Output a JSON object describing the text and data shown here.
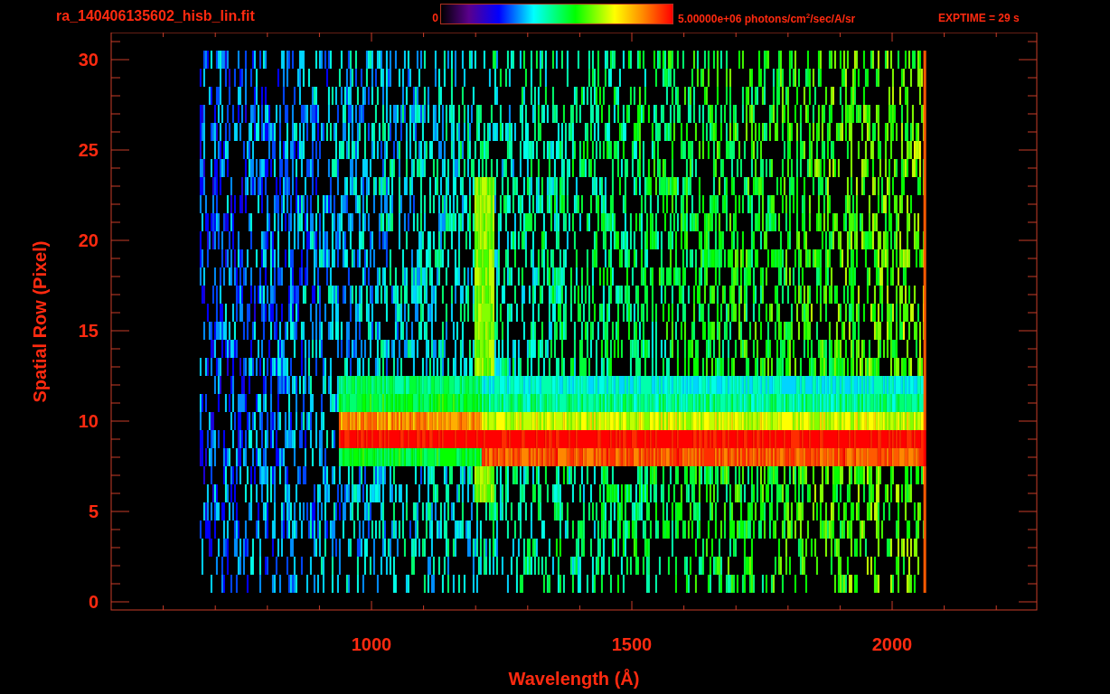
{
  "header": {
    "file_name": "ra_140406135602_hisb_lin.fit",
    "colorbar": {
      "min_label": "0",
      "max_label": "5.00000e+06 photons/cm$^{2}$/sec/A/sr"
    },
    "exposure": "EXPTIME = 29 s"
  },
  "plot": {
    "x_axis": {
      "title": "Wavelength (Å)",
      "tick_labels": [
        "1000",
        "1500",
        "2000"
      ]
    },
    "y_axis": {
      "title": "Spatial Row (Pixel)",
      "tick_labels": [
        "30",
        "25",
        "20",
        "15",
        "10",
        "5",
        "0"
      ]
    }
  }
}
